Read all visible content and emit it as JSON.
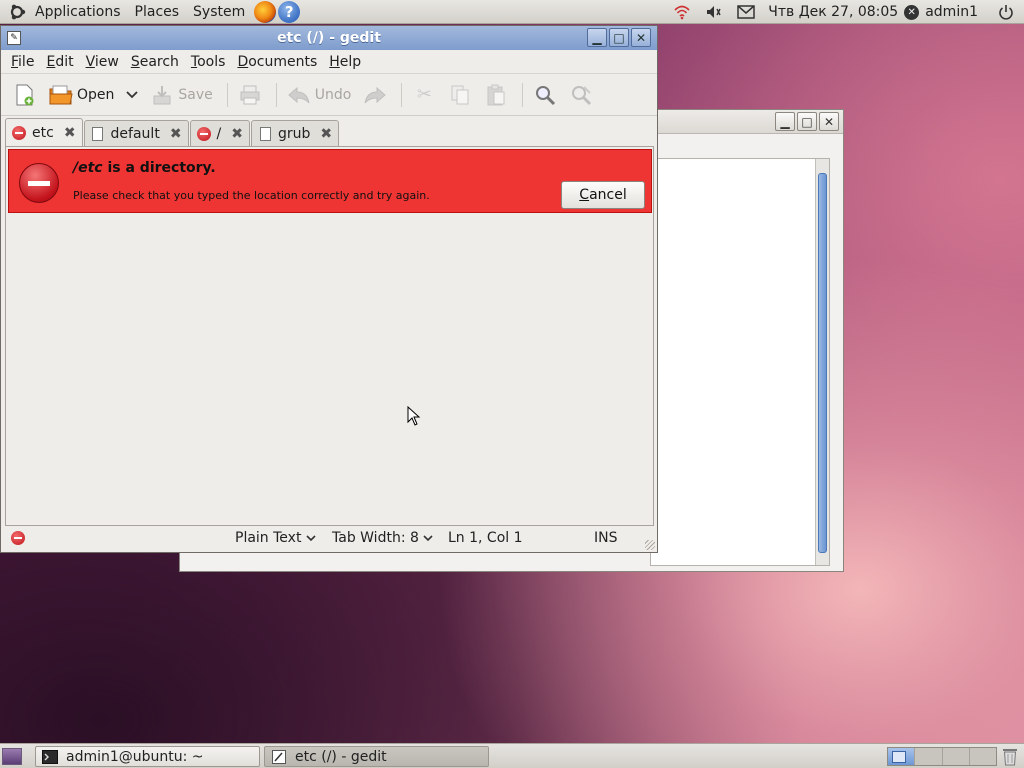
{
  "top_panel": {
    "menus": [
      "Applications",
      "Places",
      "System"
    ],
    "clock": "Чтв Дек 27, 08:05",
    "user": "admin1"
  },
  "window": {
    "title": "etc (/) - gedit"
  },
  "menubar": [
    {
      "label": "File",
      "mnemonic": "F",
      "rest": "ile"
    },
    {
      "label": "Edit",
      "mnemonic": "E",
      "rest": "dit"
    },
    {
      "label": "View",
      "mnemonic": "V",
      "rest": "iew"
    },
    {
      "label": "Search",
      "mnemonic": "S",
      "rest": "earch"
    },
    {
      "label": "Tools",
      "mnemonic": "T",
      "rest": "ools"
    },
    {
      "label": "Documents",
      "mnemonic": "D",
      "rest": "ocuments"
    },
    {
      "label": "Help",
      "mnemonic": "H",
      "rest": "elp"
    }
  ],
  "toolbar": {
    "open_label": "Open",
    "save_label": "Save",
    "undo_label": "Undo"
  },
  "tabs": [
    {
      "label": "etc",
      "icon": "error-icon",
      "active": true
    },
    {
      "label": "default",
      "icon": "document-icon",
      "active": false
    },
    {
      "label": "/",
      "icon": "error-icon",
      "active": false
    },
    {
      "label": "grub",
      "icon": "document-icon",
      "active": false
    }
  ],
  "infobar": {
    "primary_italic": "/etc",
    "primary_rest": " is a directory.",
    "secondary": "Please check that you typed the location correctly and try again.",
    "cancel_mnemonic": "C",
    "cancel_rest": "ancel",
    "color": "#ef3434"
  },
  "statusbar": {
    "language": "Plain Text",
    "tab_width_label": "Tab Width:",
    "tab_width_value": "8",
    "position": "Ln 1, Col 1",
    "mode": "INS"
  },
  "taskbar": [
    {
      "label": "admin1@ubuntu: ~",
      "icon": "terminal-icon"
    },
    {
      "label": "etc (/) - gedit",
      "icon": "gedit-icon"
    }
  ]
}
